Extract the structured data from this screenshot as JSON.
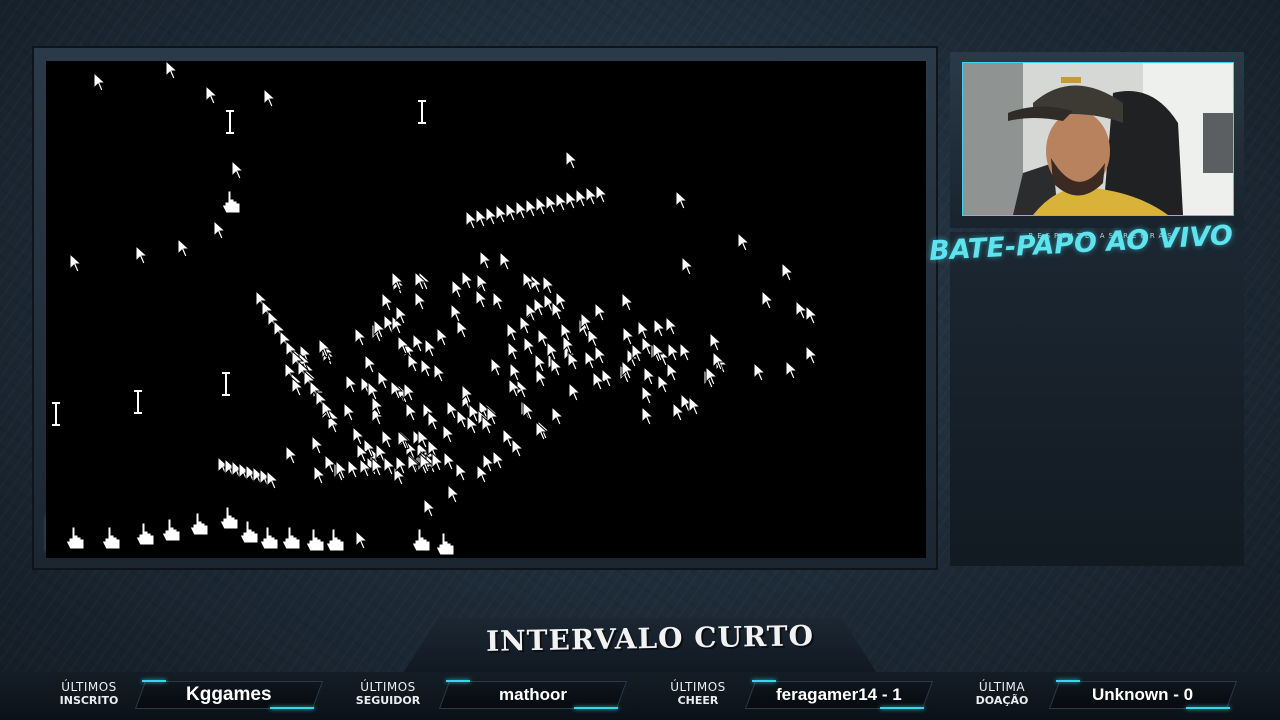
{
  "overlay": {
    "chat_subtitle": "RESPEITE AS REGRAS",
    "chat_title": "BATE-PAPO AO VIVO",
    "break_title": "INTERVALO CURTO"
  },
  "stats": [
    {
      "label_top": "ÚLTIMOS",
      "label_bottom": "INSCRITO",
      "value": "Kggames"
    },
    {
      "label_top": "ÚLTIMOS",
      "label_bottom": "SEGUIDOR",
      "value": "mathoor"
    },
    {
      "label_top": "ÚLTIMOS",
      "label_bottom": "CHEER",
      "value": "feragamer14 - 1"
    },
    {
      "label_top": "ÚLTIMA",
      "label_bottom": "DOAÇÃO",
      "value": "Unknown - 0"
    }
  ],
  "colors": {
    "accent": "#38d7e6",
    "background": "#1d2a36"
  },
  "icons": [
    "arrow-cursor-icon",
    "text-cursor-icon",
    "hand-cursor-icon"
  ]
}
